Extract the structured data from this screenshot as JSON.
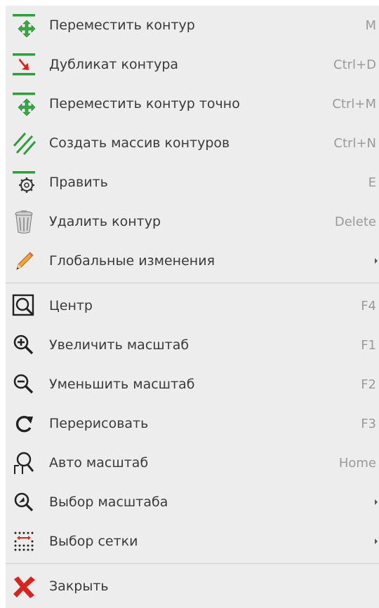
{
  "menu": {
    "items": [
      {
        "label": "Переместить контур",
        "shortcut": "M",
        "icon": "move-contour-icon"
      },
      {
        "label": "Дубликат контура",
        "shortcut": "Ctrl+D",
        "icon": "duplicate-contour-icon"
      },
      {
        "label": "Переместить контур точно",
        "shortcut": "Ctrl+M",
        "icon": "move-exact-icon"
      },
      {
        "label": "Создать массив контуров",
        "shortcut": "Ctrl+N",
        "icon": "array-contours-icon"
      },
      {
        "label": "Править",
        "shortcut": "E",
        "icon": "edit-gear-icon"
      },
      {
        "label": "Удалить контур",
        "shortcut": "Delete",
        "icon": "trash-icon"
      },
      {
        "label": "Глобальные изменения",
        "shortcut": "",
        "icon": "pencil-icon",
        "submenu": true
      },
      {
        "label": "Центр",
        "shortcut": "F4",
        "icon": "center-icon"
      },
      {
        "label": "Увеличить масштаб",
        "shortcut": "F1",
        "icon": "zoom-in-icon"
      },
      {
        "label": "Уменьшить масштаб",
        "shortcut": "F2",
        "icon": "zoom-out-icon"
      },
      {
        "label": "Перерисовать",
        "shortcut": "F3",
        "icon": "redraw-icon"
      },
      {
        "label": "Авто масштаб",
        "shortcut": "Home",
        "icon": "auto-zoom-icon"
      },
      {
        "label": "Выбор масштаба",
        "shortcut": "",
        "icon": "zoom-select-icon",
        "submenu": true
      },
      {
        "label": "Выбор сетки",
        "shortcut": "",
        "icon": "grid-select-icon",
        "submenu": true
      },
      {
        "label": "Закрыть",
        "shortcut": "",
        "icon": "close-icon"
      }
    ]
  },
  "colors": {
    "menu_bg": "#ededed",
    "text": "#3a3a3a",
    "shortcut": "#9a9a9a",
    "green": "#2e9e3a",
    "red": "#d9231f"
  }
}
